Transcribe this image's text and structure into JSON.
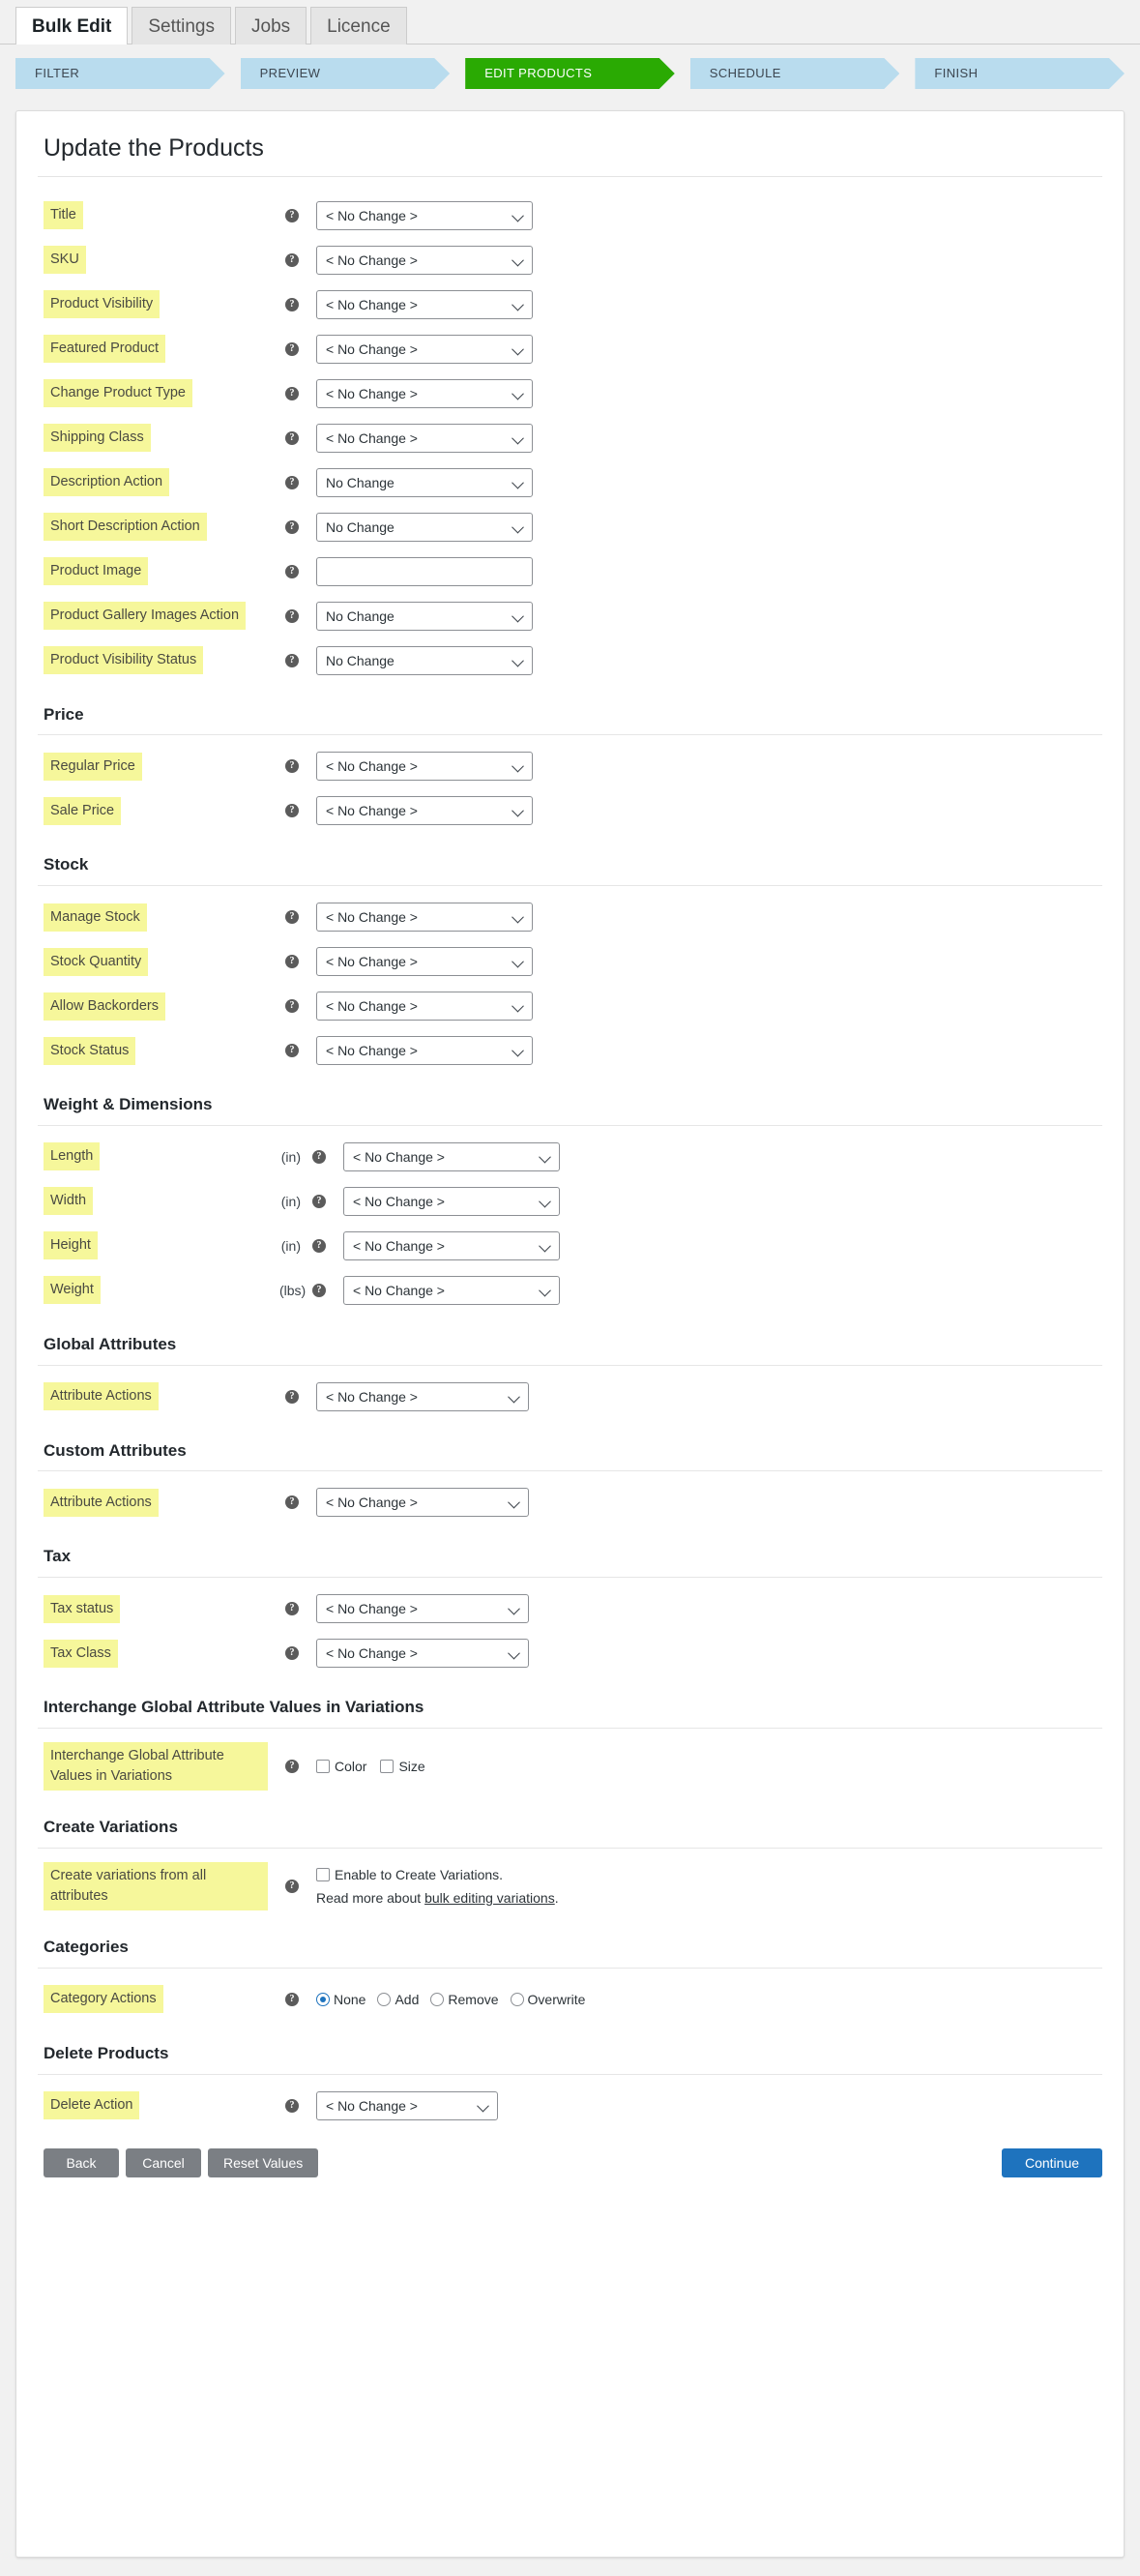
{
  "tabs": [
    {
      "label": "Bulk Edit",
      "active": true
    },
    {
      "label": "Settings",
      "active": false
    },
    {
      "label": "Jobs",
      "active": false
    },
    {
      "label": "Licence",
      "active": false
    }
  ],
  "steps": [
    {
      "label": "FILTER",
      "active": false
    },
    {
      "label": "PREVIEW",
      "active": false
    },
    {
      "label": "EDIT PRODUCTS",
      "active": true
    },
    {
      "label": "SCHEDULE",
      "active": false
    },
    {
      "label": "FINISH",
      "active": false
    }
  ],
  "panel": {
    "title": "Update the Products"
  },
  "help_icon": "?",
  "no_change_angle": "< No Change >",
  "no_change_plain": "No Change",
  "rows": {
    "title": {
      "label": "Title",
      "value": "< No Change >"
    },
    "sku": {
      "label": "SKU",
      "value": "< No Change >"
    },
    "product_visibility": {
      "label": "Product Visibility",
      "value": "< No Change >"
    },
    "featured_product": {
      "label": "Featured Product",
      "value": "< No Change >"
    },
    "change_product_type": {
      "label": "Change Product Type",
      "value": "< No Change >"
    },
    "shipping_class": {
      "label": "Shipping Class",
      "value": "< No Change >"
    },
    "description_action": {
      "label": "Description Action",
      "value": "No Change"
    },
    "short_description_action": {
      "label": "Short Description Action",
      "value": "No Change"
    },
    "product_image": {
      "label": "Product Image",
      "value": "",
      "placeholder": ""
    },
    "product_gallery_images_action": {
      "label": "Product Gallery Images Action",
      "value": "No Change"
    },
    "product_visibility_status": {
      "label": "Product Visibility Status",
      "value": "No Change"
    },
    "regular_price": {
      "label": "Regular Price",
      "value": "< No Change >"
    },
    "sale_price": {
      "label": "Sale Price",
      "value": "< No Change >"
    },
    "manage_stock": {
      "label": "Manage Stock",
      "value": "< No Change >"
    },
    "stock_quantity": {
      "label": "Stock Quantity",
      "value": "< No Change >"
    },
    "allow_backorders": {
      "label": "Allow Backorders",
      "value": "< No Change >"
    },
    "stock_status": {
      "label": "Stock Status",
      "value": "< No Change >"
    },
    "length": {
      "label": "Length",
      "unit": "(in)",
      "value": "< No Change >"
    },
    "width": {
      "label": "Width",
      "unit": "(in)",
      "value": "< No Change >"
    },
    "height": {
      "label": "Height",
      "unit": "(in)",
      "value": "< No Change >"
    },
    "weight": {
      "label": "Weight",
      "unit": "(lbs)",
      "value": "< No Change >"
    },
    "global_attribute_actions": {
      "label": "Attribute Actions",
      "value": "< No Change >"
    },
    "custom_attribute_actions": {
      "label": "Attribute Actions",
      "value": "< No Change >"
    },
    "tax_status": {
      "label": "Tax status",
      "value": "< No Change >"
    },
    "tax_class": {
      "label": "Tax Class",
      "value": "< No Change >"
    },
    "interchange": {
      "label": "Interchange Global Attribute Values in Variations",
      "checkboxes": [
        {
          "label": "Color",
          "checked": false
        },
        {
          "label": "Size",
          "checked": false
        }
      ]
    },
    "create_variations": {
      "label": "Create variations from all attributes",
      "checkbox_label": "Enable to Create Variations.",
      "checked": false,
      "note_prefix": "Read more about ",
      "note_link": "bulk editing variations",
      "note_suffix": "."
    },
    "category_actions": {
      "label": "Category Actions",
      "radios": [
        {
          "label": "None",
          "checked": true
        },
        {
          "label": "Add",
          "checked": false
        },
        {
          "label": "Remove",
          "checked": false
        },
        {
          "label": "Overwrite",
          "checked": false
        }
      ]
    },
    "delete_action": {
      "label": "Delete Action",
      "value": "< No Change >"
    }
  },
  "sections": {
    "price": "Price",
    "stock": "Stock",
    "weight_dimensions": "Weight & Dimensions",
    "global_attributes": "Global Attributes",
    "custom_attributes": "Custom Attributes",
    "tax": "Tax",
    "interchange": "Interchange Global Attribute Values in Variations",
    "create_variations": "Create Variations",
    "categories": "Categories",
    "delete_products": "Delete Products"
  },
  "footer": {
    "back": "Back",
    "cancel": "Cancel",
    "reset": "Reset Values",
    "continue": "Continue"
  }
}
